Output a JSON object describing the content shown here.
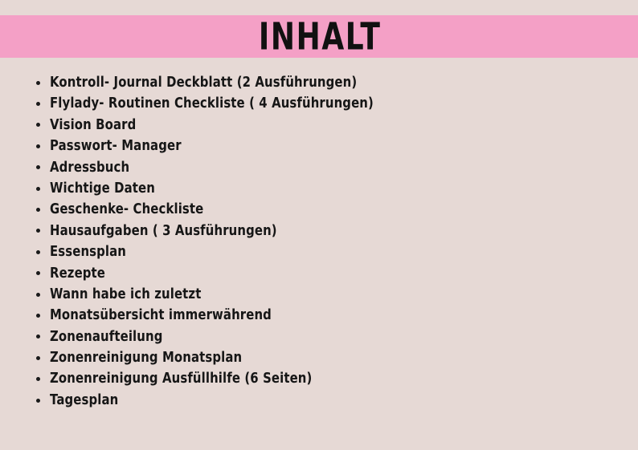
{
  "page": {
    "background_color": "#e6d9d5",
    "text_color": "#161616"
  },
  "header": {
    "title": "INHALT",
    "band_color": "#f4a0c6",
    "title_color": "#111111"
  },
  "contents": {
    "bullet_color": "#1a1a1a",
    "items": [
      {
        "label": "Kontroll- Journal Deckblatt (2 Ausführungen)"
      },
      {
        "label": "Flylady- Routinen Checkliste ( 4 Ausführungen)"
      },
      {
        "label": "Vision Board"
      },
      {
        "label": "Passwort- Manager"
      },
      {
        "label": "Adressbuch"
      },
      {
        "label": "Wichtige Daten"
      },
      {
        "label": "Geschenke- Checkliste"
      },
      {
        "label": "Hausaufgaben ( 3 Ausführungen)"
      },
      {
        "label": "Essensplan"
      },
      {
        "label": "Rezepte"
      },
      {
        "label": "Wann habe ich zuletzt"
      },
      {
        "label": "Monatsübersicht immerwährend"
      },
      {
        "label": "Zonenaufteilung"
      },
      {
        "label": "Zonenreinigung Monatsplan"
      },
      {
        "label": "Zonenreinigung Ausfüllhilfe (6 Seiten)"
      },
      {
        "label": "Tagesplan"
      }
    ]
  }
}
